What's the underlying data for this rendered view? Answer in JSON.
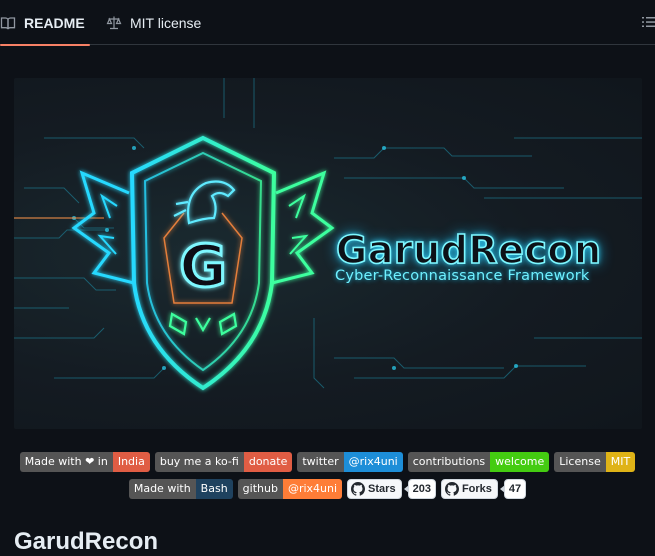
{
  "tabs": [
    {
      "label": "README",
      "icon": "book-icon",
      "active": true
    },
    {
      "label": "MIT license",
      "icon": "law-icon",
      "active": false
    }
  ],
  "banner": {
    "title": "GarudRecon",
    "subtitle": "Cyber-Reconnaissance Framework",
    "emblem_letter": "G"
  },
  "badges": [
    {
      "left": "Made with ❤ in",
      "right": "India",
      "color": "#e05d44"
    },
    {
      "left": "buy me a ko-fi",
      "right": "donate",
      "color": "#e05d44"
    },
    {
      "left": "twitter",
      "right": "@rix4uni",
      "color": "#1d8ed8"
    },
    {
      "left": "contributions",
      "right": "welcome",
      "color": "#4c1"
    },
    {
      "left": "License",
      "right": "MIT",
      "color": "#dfb317"
    },
    {
      "left": "Made with",
      "right": "Bash",
      "color": "#1f425f"
    },
    {
      "left": "github",
      "right": "@rix4uni",
      "color": "#fe7d37"
    }
  ],
  "github_buttons": [
    {
      "label": "Stars",
      "count": "203"
    },
    {
      "label": "Forks",
      "count": "47"
    }
  ],
  "readme_heading": "GarudRecon",
  "colors": {
    "accent": "#f78166",
    "neon_cyan": "#37d8ff",
    "neon_green": "#3cff9e"
  }
}
